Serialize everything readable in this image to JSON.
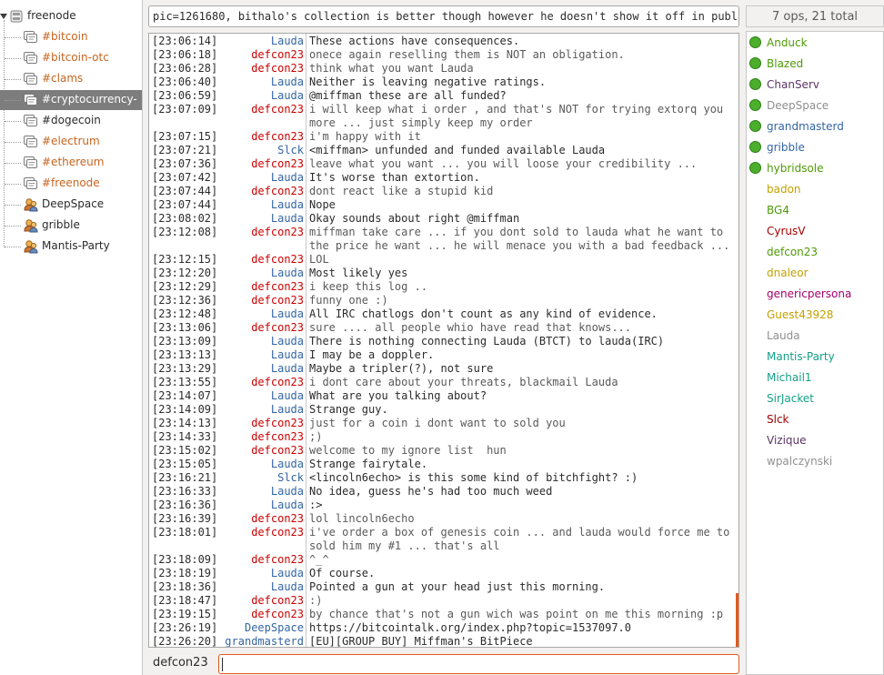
{
  "tree": {
    "server": "freenode",
    "items": [
      {
        "label": "#bitcoin",
        "kind": "channel",
        "marked": true
      },
      {
        "label": "#bitcoin-otc",
        "kind": "channel",
        "marked": true
      },
      {
        "label": "#clams",
        "kind": "channel",
        "marked": true
      },
      {
        "label": "#cryptocurrency-",
        "kind": "channel",
        "marked": false,
        "selected": true
      },
      {
        "label": "#dogecoin",
        "kind": "channel",
        "marked": false
      },
      {
        "label": "#electrum",
        "kind": "channel",
        "marked": true
      },
      {
        "label": "#ethereum",
        "kind": "channel",
        "marked": true
      },
      {
        "label": "#freenode",
        "kind": "channel",
        "marked": true
      },
      {
        "label": "DeepSpace",
        "kind": "query",
        "marked": false
      },
      {
        "label": "gribble",
        "kind": "query",
        "marked": false
      },
      {
        "label": "Mantis-Party",
        "kind": "query",
        "marked": false
      }
    ]
  },
  "topic": "pic=1261680, bithalo's collection is better though however he doesn't show it off in public.",
  "messages": [
    {
      "ts": "[23:06:14]",
      "nick": "Lauda",
      "color": "#3465a4",
      "text": "These actions have consequences."
    },
    {
      "ts": "[23:06:18]",
      "nick": "defcon23",
      "color": "#cc0000",
      "text": "onece again reselling them is NOT an obligation.",
      "grey": true
    },
    {
      "ts": "[23:06:28]",
      "nick": "defcon23",
      "color": "#cc0000",
      "text": "think what you want Lauda",
      "grey": true
    },
    {
      "ts": "[23:06:40]",
      "nick": "Lauda",
      "color": "#3465a4",
      "text": "Neither is leaving negative ratings."
    },
    {
      "ts": "[23:06:59]",
      "nick": "Lauda",
      "color": "#3465a4",
      "text": "@miffman these are all funded?"
    },
    {
      "ts": "[23:07:09]",
      "nick": "defcon23",
      "color": "#cc0000",
      "text": "i will keep what i order , and that's NOT for trying extorq you",
      "grey": true
    },
    {
      "ts": "",
      "nick": "",
      "color": "#cc0000",
      "text": "more ... just simply keep my order",
      "grey": true
    },
    {
      "ts": "[23:07:15]",
      "nick": "defcon23",
      "color": "#cc0000",
      "text": "i'm happy with it",
      "grey": true
    },
    {
      "ts": "[23:07:21]",
      "nick": "Slck",
      "color": "#3465a4",
      "text": "<miffman> unfunded and funded available Lauda"
    },
    {
      "ts": "[23:07:36]",
      "nick": "defcon23",
      "color": "#cc0000",
      "text": "leave what you want ... you will loose your credibility ...",
      "grey": true
    },
    {
      "ts": "[23:07:42]",
      "nick": "Lauda",
      "color": "#3465a4",
      "text": "It's worse than extortion."
    },
    {
      "ts": "[23:07:44]",
      "nick": "defcon23",
      "color": "#cc0000",
      "text": "dont react like a stupid kid",
      "grey": true
    },
    {
      "ts": "[23:07:44]",
      "nick": "Lauda",
      "color": "#3465a4",
      "text": "Nope"
    },
    {
      "ts": "[23:08:02]",
      "nick": "Lauda",
      "color": "#3465a4",
      "text": "Okay sounds about right @miffman"
    },
    {
      "ts": "[23:12:08]",
      "nick": "defcon23",
      "color": "#cc0000",
      "text": "miffman take care ... if you dont sold to lauda what he want to",
      "grey": true
    },
    {
      "ts": "",
      "nick": "",
      "color": "#cc0000",
      "text": "the price he want ... he will menace you with a bad feedback ... ;)",
      "grey": true
    },
    {
      "ts": "[23:12:15]",
      "nick": "defcon23",
      "color": "#cc0000",
      "text": "LOL",
      "grey": true
    },
    {
      "ts": "[23:12:20]",
      "nick": "Lauda",
      "color": "#3465a4",
      "text": "Most likely yes"
    },
    {
      "ts": "[23:12:29]",
      "nick": "defcon23",
      "color": "#cc0000",
      "text": "i keep this log ..",
      "grey": true
    },
    {
      "ts": "[23:12:36]",
      "nick": "defcon23",
      "color": "#cc0000",
      "text": "funny one :)",
      "grey": true
    },
    {
      "ts": "[23:12:48]",
      "nick": "Lauda",
      "color": "#3465a4",
      "text": "All IRC chatlogs don't count as any kind of evidence."
    },
    {
      "ts": "[23:13:06]",
      "nick": "defcon23",
      "color": "#cc0000",
      "text": "sure .... all people whio have read that knows...",
      "grey": true
    },
    {
      "ts": "[23:13:09]",
      "nick": "Lauda",
      "color": "#3465a4",
      "text": "There is nothing connecting Lauda (BTCT) to lauda(IRC)"
    },
    {
      "ts": "[23:13:13]",
      "nick": "Lauda",
      "color": "#3465a4",
      "text": "I may be a doppler."
    },
    {
      "ts": "[23:13:29]",
      "nick": "Lauda",
      "color": "#3465a4",
      "text": "Maybe a tripler(?), not sure"
    },
    {
      "ts": "[23:13:55]",
      "nick": "defcon23",
      "color": "#cc0000",
      "text": "i dont care about your threats, blackmail Lauda",
      "grey": true
    },
    {
      "ts": "[23:14:07]",
      "nick": "Lauda",
      "color": "#3465a4",
      "text": "What are you talking about?"
    },
    {
      "ts": "[23:14:09]",
      "nick": "Lauda",
      "color": "#3465a4",
      "text": "Strange guy."
    },
    {
      "ts": "[23:14:13]",
      "nick": "defcon23",
      "color": "#cc0000",
      "text": "just for a coin i dont want to sold you",
      "grey": true
    },
    {
      "ts": "[23:14:33]",
      "nick": "defcon23",
      "color": "#cc0000",
      "text": ";)",
      "grey": true
    },
    {
      "ts": "[23:15:02]",
      "nick": "defcon23",
      "color": "#cc0000",
      "text": "welcome to my ignore list  hun",
      "grey": true
    },
    {
      "ts": "[23:15:05]",
      "nick": "Lauda",
      "color": "#3465a4",
      "text": "Strange fairytale."
    },
    {
      "ts": "[23:16:21]",
      "nick": "Slck",
      "color": "#3465a4",
      "text": "<lincoln6echo> is this some kind of bitchfight? :)"
    },
    {
      "ts": "[23:16:33]",
      "nick": "Lauda",
      "color": "#3465a4",
      "text": "No idea, guess he's had too much weed"
    },
    {
      "ts": "[23:16:36]",
      "nick": "Lauda",
      "color": "#3465a4",
      "text": ":>"
    },
    {
      "ts": "[23:16:39]",
      "nick": "defcon23",
      "color": "#cc0000",
      "text": "lol lincoln6echo",
      "grey": true
    },
    {
      "ts": "[23:18:01]",
      "nick": "defcon23",
      "color": "#cc0000",
      "text": "i've order a box of genesis coin ... and lauda would force me to",
      "grey": true
    },
    {
      "ts": "",
      "nick": "",
      "color": "#cc0000",
      "text": "sold him my #1 ... that's all",
      "grey": true
    },
    {
      "ts": "[23:18:09]",
      "nick": "defcon23",
      "color": "#cc0000",
      "text": "^_^",
      "grey": true
    },
    {
      "ts": "[23:18:19]",
      "nick": "Lauda",
      "color": "#3465a4",
      "text": "Of course."
    },
    {
      "ts": "[23:18:36]",
      "nick": "Lauda",
      "color": "#3465a4",
      "text": "Pointed a gun at your head just this morning."
    },
    {
      "ts": "[23:18:47]",
      "nick": "defcon23",
      "color": "#cc0000",
      "text": ":)",
      "grey": true
    },
    {
      "ts": "[23:19:15]",
      "nick": "defcon23",
      "color": "#cc0000",
      "text": "by chance that's not a gun wich was point on me this morning :p",
      "grey": true
    },
    {
      "ts": "[23:26:19]",
      "nick": "DeepSpace",
      "color": "#3465a4",
      "text": "https://bitcointalk.org/index.php?topic=1537097.0"
    },
    {
      "ts": "[23:26:20]",
      "nick": "grandmasterd",
      "color": "#3465a4",
      "text": "[EU][GROUP BUY] Miffman's BitPiece"
    }
  ],
  "input": {
    "nick": "defcon23",
    "value": ""
  },
  "userlist": {
    "header": "7 ops, 21 total",
    "users": [
      {
        "name": "Anduck",
        "op": true,
        "color": "#4e9a06"
      },
      {
        "name": "Blazed",
        "op": true,
        "color": "#4e9a06"
      },
      {
        "name": "ChanServ",
        "op": true,
        "color": "#5c3566"
      },
      {
        "name": "DeepSpace",
        "op": true,
        "color": "#8f8f8f"
      },
      {
        "name": "grandmasterd",
        "op": true,
        "color": "#3465a4"
      },
      {
        "name": "gribble",
        "op": true,
        "color": "#3465a4"
      },
      {
        "name": "hybridsole",
        "op": true,
        "color": "#4e9a06"
      },
      {
        "name": "badon",
        "op": false,
        "color": "#c4a000"
      },
      {
        "name": "BG4",
        "op": false,
        "color": "#4e9a06"
      },
      {
        "name": "CyrusV",
        "op": false,
        "color": "#a40000"
      },
      {
        "name": "defcon23",
        "op": false,
        "color": "#4e9a06"
      },
      {
        "name": "dnaleor",
        "op": false,
        "color": "#c4a000"
      },
      {
        "name": "genericpersona",
        "op": false,
        "color": "#a4006a"
      },
      {
        "name": "Guest43928",
        "op": false,
        "color": "#c4a000"
      },
      {
        "name": "Lauda",
        "op": false,
        "color": "#8f8f8f"
      },
      {
        "name": "Mantis-Party",
        "op": false,
        "color": "#16a085"
      },
      {
        "name": "Michail1",
        "op": false,
        "color": "#16a085"
      },
      {
        "name": "SirJacket",
        "op": false,
        "color": "#16a085"
      },
      {
        "name": "Slck",
        "op": false,
        "color": "#a40000"
      },
      {
        "name": "Vizique",
        "op": false,
        "color": "#5c3566"
      },
      {
        "name": "wpalczynski",
        "op": false,
        "color": "#8f8f8f"
      }
    ]
  }
}
